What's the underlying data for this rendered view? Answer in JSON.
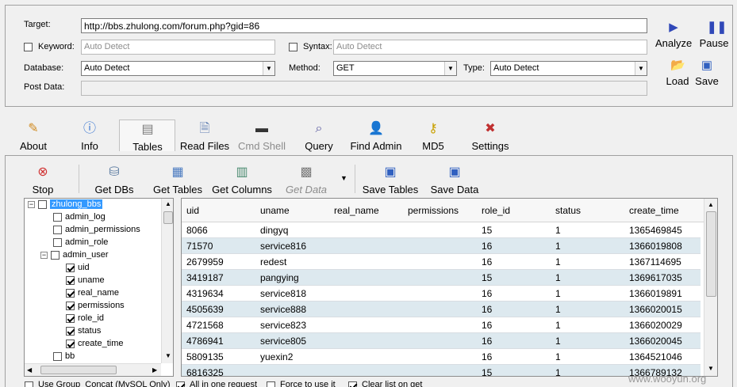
{
  "target": {
    "label": "Target:",
    "value": "http://bbs.zhulong.com/forum.php?gid=86"
  },
  "keyword": {
    "label": "Keyword:",
    "placeholder": "Auto Detect",
    "checked": false
  },
  "syntax": {
    "label": "Syntax:",
    "placeholder": "Auto Detect",
    "checked": false
  },
  "database": {
    "label": "Database:",
    "value": "Auto Detect"
  },
  "method": {
    "label": "Method:",
    "value": "GET"
  },
  "type": {
    "label": "Type:",
    "value": "Auto Detect"
  },
  "post_data": {
    "label": "Post Data:",
    "value": ""
  },
  "actions": {
    "analyze": "Analyze",
    "pause": "Pause",
    "load": "Load",
    "save": "Save"
  },
  "tabs": {
    "about": "About",
    "info": "Info",
    "tables": "Tables",
    "read_files": "Read Files",
    "cmd_shell": "Cmd Shell",
    "query": "Query",
    "find_admin": "Find Admin",
    "md5": "MD5",
    "settings": "Settings"
  },
  "toolbar": {
    "stop": "Stop",
    "get_dbs": "Get DBs",
    "get_tables": "Get Tables",
    "get_columns": "Get Columns",
    "get_data": "Get Data",
    "save_tables": "Save Tables",
    "save_data": "Save Data"
  },
  "tree": {
    "db": "zhulong_bbs",
    "tables": [
      "admin_log",
      "admin_permissions",
      "admin_role",
      "admin_user"
    ],
    "columns": [
      "uid",
      "uname",
      "real_name",
      "permissions",
      "role_id",
      "status",
      "create_time"
    ],
    "next_table": "bb"
  },
  "grid": {
    "headers": [
      "uid",
      "uname",
      "real_name",
      "permissions",
      "role_id",
      "status",
      "create_time"
    ],
    "rows": [
      [
        "8066",
        "dingyq",
        "",
        "",
        "15",
        "1",
        "1365469845"
      ],
      [
        "71570",
        "service816",
        "",
        "",
        "16",
        "1",
        "1366019808"
      ],
      [
        "2679959",
        "redest",
        "",
        "",
        "16",
        "1",
        "1367114695"
      ],
      [
        "3419187",
        "pangying",
        "",
        "",
        "15",
        "1",
        "1369617035"
      ],
      [
        "4319634",
        "service818",
        "",
        "",
        "16",
        "1",
        "1366019891"
      ],
      [
        "4505639",
        "service888",
        "",
        "",
        "16",
        "1",
        "1366020015"
      ],
      [
        "4721568",
        "service823",
        "",
        "",
        "16",
        "1",
        "1366020029"
      ],
      [
        "4786941",
        "service805",
        "",
        "",
        "16",
        "1",
        "1366020045"
      ],
      [
        "5809135",
        "yuexin2",
        "",
        "",
        "16",
        "1",
        "1364521046"
      ],
      [
        "6816325",
        "",
        "",
        "",
        "15",
        "1",
        "1366789132"
      ]
    ]
  },
  "options": {
    "group_concat": "Use Group_Concat (MySQL Only)",
    "all_in_one": "All in one request",
    "force": "Force to use it",
    "clear_list": "Clear list on get"
  },
  "watermark": "www.wooyun.org"
}
